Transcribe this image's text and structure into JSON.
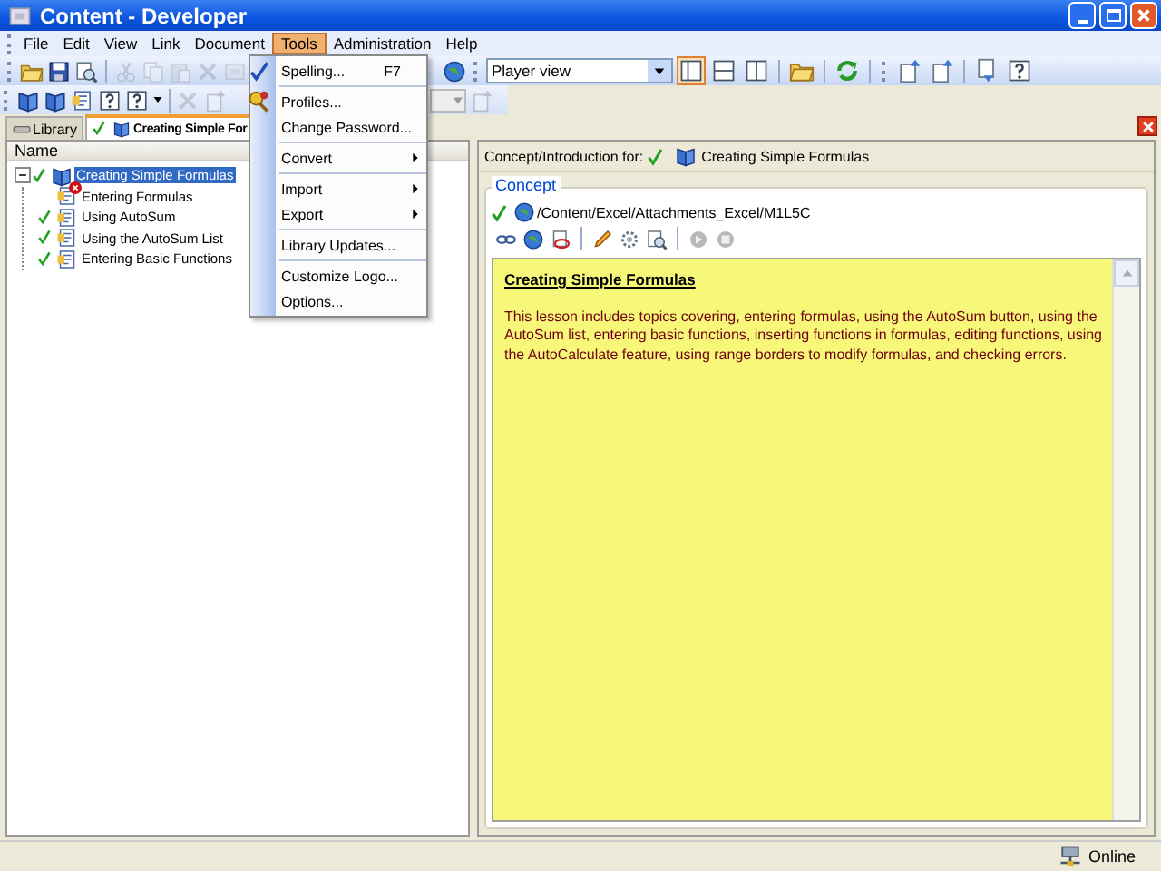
{
  "window": {
    "title": "Content - Developer"
  },
  "menu_bar": [
    {
      "label": "File",
      "selected": false
    },
    {
      "label": "Edit",
      "selected": false
    },
    {
      "label": "View",
      "selected": false
    },
    {
      "label": "Link",
      "selected": false
    },
    {
      "label": "Document",
      "selected": false
    },
    {
      "label": "Tools",
      "selected": true
    },
    {
      "label": "Administration",
      "selected": false
    },
    {
      "label": "Help",
      "selected": false
    }
  ],
  "tools_menu": [
    [
      {
        "label": "Spelling...",
        "shortcut": "F7",
        "submenu": false
      }
    ],
    [
      {
        "label": "Profiles...",
        "submenu": false
      },
      {
        "label": "Change Password...",
        "submenu": false
      }
    ],
    [
      {
        "label": "Convert",
        "submenu": true
      }
    ],
    [
      {
        "label": "Import",
        "submenu": true
      },
      {
        "label": "Export",
        "submenu": true
      }
    ],
    [
      {
        "label": "Library Updates...",
        "submenu": false
      }
    ],
    [
      {
        "label": "Customize Logo...",
        "submenu": false
      },
      {
        "label": "Options...",
        "submenu": false
      }
    ]
  ],
  "toolbar_1": {
    "buttons_left": [
      {
        "disabled": false
      },
      {
        "disabled": false
      },
      {
        "disabled": false
      },
      {
        "disabled": true
      },
      {
        "disabled": true
      },
      {
        "disabled": true
      },
      {
        "disabled": true
      },
      {
        "disabled": true
      }
    ],
    "view_dropdown": {
      "value": "Player view"
    },
    "buttons_right": [
      {
        "selected": true
      },
      {
        "selected": false
      },
      {
        "selected": false
      },
      {
        "selected": false
      },
      {
        "selected": false
      },
      {
        "selected": false
      },
      {
        "selected": false
      },
      {
        "selected": false
      },
      {
        "selected": false
      }
    ]
  },
  "toolbar_2": {
    "buttons": [
      {
        "disabled": false
      },
      {
        "disabled": false
      },
      {
        "disabled": false
      },
      {
        "disabled": false
      },
      {
        "disabled": false
      },
      {
        "disabled": true
      },
      {
        "disabled": true
      }
    ]
  },
  "tabs": [
    {
      "label": "Library",
      "selected": false
    },
    {
      "label": "Creating Simple For",
      "selected": true
    }
  ],
  "tree": {
    "column": "Name",
    "items": [
      {
        "label": "Creating Simple Formulas",
        "checked": true,
        "expanded": true,
        "selected": true,
        "children": [
          {
            "label": "Entering Formulas",
            "checked": false,
            "selected": false
          },
          {
            "label": "Using AutoSum",
            "checked": true,
            "selected": false
          },
          {
            "label": "Using the AutoSum List",
            "checked": true,
            "selected": false
          },
          {
            "label": "Entering Basic Functions",
            "checked": true,
            "selected": false
          }
        ]
      }
    ]
  },
  "detail": {
    "header_label": "Concept/Introduction for:",
    "header_title": "Creating Simple Formulas",
    "header_checked": true,
    "group_title": "Concept",
    "path": "/Content/Excel/Attachments_Excel/M1L5C",
    "path_checked": true,
    "content": {
      "heading": "Creating Simple Formulas",
      "body": "This lesson includes topics covering, entering formulas, using the AutoSum button, using the AutoSum list, entering basic functions, inserting functions in formulas, editing functions, using the AutoCalculate feature, using range borders to modify formulas, and checking errors."
    }
  },
  "status_bar": {
    "connection": "Online"
  }
}
